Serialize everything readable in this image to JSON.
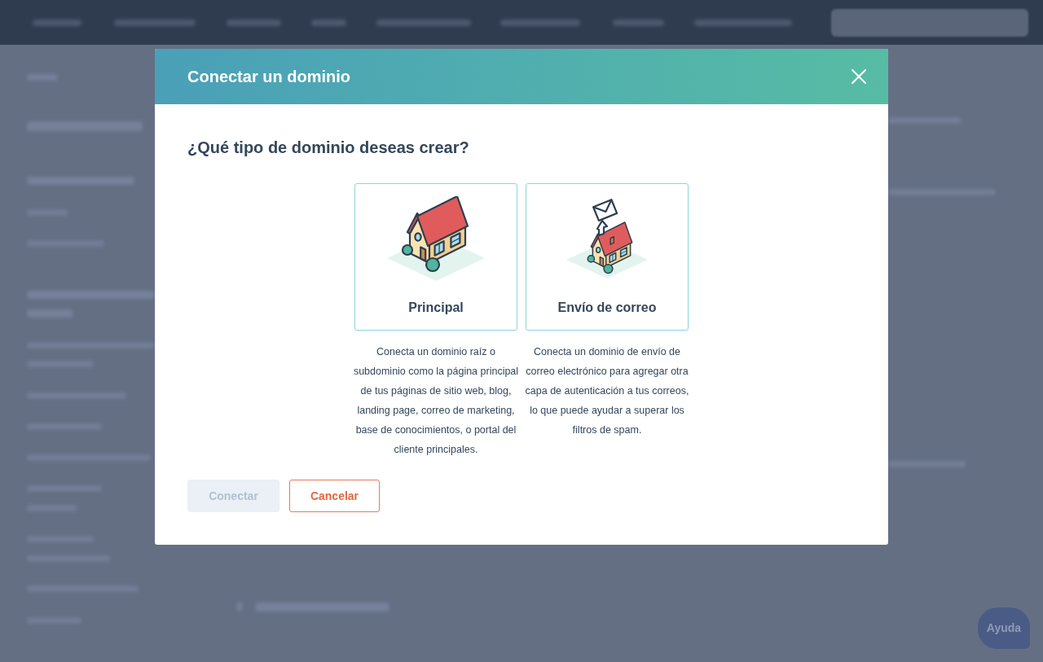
{
  "background": {
    "help_button": {
      "label": "Ayuda"
    }
  },
  "dialog": {
    "title": "Conectar un dominio",
    "question": "¿Qué tipo de dominio deseas crear?",
    "options": [
      {
        "kind": "root",
        "label": "Principal",
        "selected": false,
        "description": "Conecta un dominio raíz o subdominio como la página principal de tus páginas de sitio web, blog, landing page, correo de marketing, base de conocimientos, o portal del cliente principales."
      },
      {
        "kind": "email",
        "label": "Envío de correo",
        "selected": false,
        "description": "Conecta un dominio de envío de correo electrónico para agregar otra capa de autenticación a tus correos, lo que puede ayudar a superar los filtros de spam."
      }
    ],
    "buttons": [
      {
        "kind": "primary",
        "label": "Conectar",
        "disabled": true
      },
      {
        "kind": "secondary",
        "label": "Cancelar",
        "disabled": false
      }
    ]
  }
}
